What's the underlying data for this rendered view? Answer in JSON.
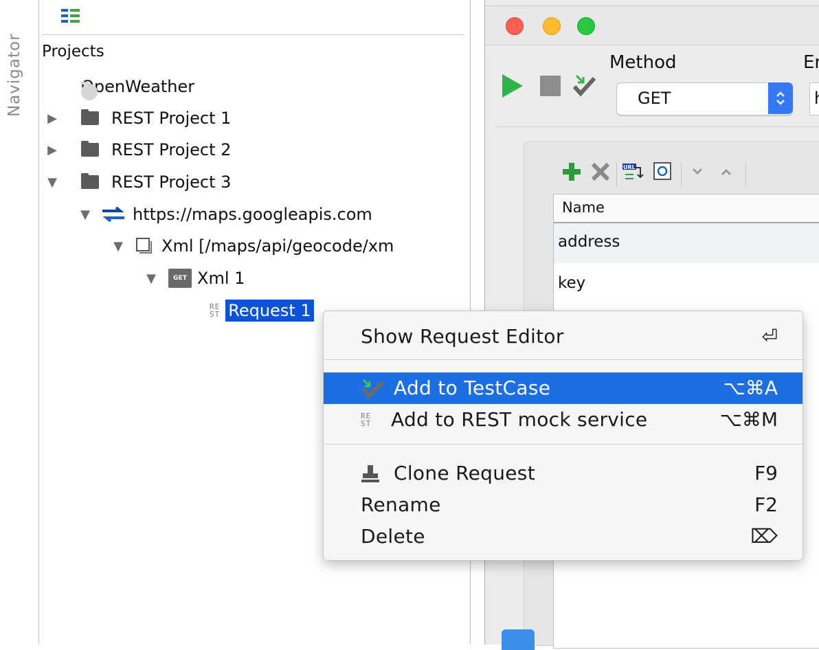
{
  "navigator": {
    "label": "Navigator"
  },
  "tree": {
    "toolbar_icon": "tree-view-icon",
    "heading": "Projects",
    "nodes": [
      {
        "label": "OpenWeather",
        "icon": "folder-icon"
      },
      {
        "label": "REST Project 1",
        "icon": "folder-icon",
        "expander": "collapsed"
      },
      {
        "label": "REST Project 2",
        "icon": "folder-icon",
        "expander": "collapsed"
      },
      {
        "label": "REST Project 3",
        "icon": "folder-icon",
        "expander": "expanded"
      },
      {
        "label": "https://maps.googleapis.com",
        "icon": "endpoint-arrows-icon",
        "expander": "expanded"
      },
      {
        "label": "Xml [/maps/api/geocode/xm",
        "icon": "resource-icon",
        "expander": "expanded"
      },
      {
        "label": "Xml 1",
        "badge": "GET",
        "expander": "expanded"
      },
      {
        "label": "Request 1",
        "icon_text_top": "RE",
        "icon_text_bottom": "ST",
        "selected": true
      }
    ]
  },
  "editor": {
    "method_label": "Method",
    "endpoint_label": "En",
    "method_value": "GET",
    "endpoint_value": "h",
    "params": {
      "column_name": "Name",
      "rows": [
        "address",
        "key"
      ]
    }
  },
  "context_menu": {
    "items": [
      {
        "label": "Show Request Editor",
        "shortcut": "⏎"
      },
      {
        "label": "Add to TestCase",
        "shortcut": "⌥⌘A",
        "icon": "add-to-testcase-icon",
        "highlighted": true
      },
      {
        "label": "Add to REST mock service",
        "shortcut": "⌥⌘M",
        "icon": "rest-icon",
        "icon_text_top": "RE",
        "icon_text_bottom": "ST"
      },
      {
        "label": "Clone Request",
        "shortcut": "F9",
        "icon": "clone-stamp-icon"
      },
      {
        "label": "Rename",
        "shortcut": "F2"
      },
      {
        "label": "Delete",
        "shortcut": "⌦"
      }
    ]
  },
  "colors": {
    "selection_blue": "#0b54d9",
    "menu_highlight": "#1d6ee3",
    "play_green": "#2db54a",
    "traffic_red": "#fd5e57",
    "traffic_yellow": "#fdbc2e",
    "traffic_green": "#28c840"
  }
}
